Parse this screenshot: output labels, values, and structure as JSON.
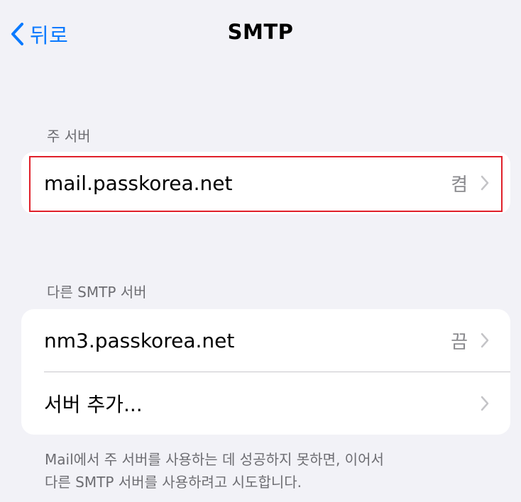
{
  "nav": {
    "back_label": "뒤로",
    "title": "SMTP"
  },
  "primary": {
    "header": "주 서버",
    "server": {
      "name": "mail.passkorea.net",
      "status": "켬"
    }
  },
  "other": {
    "header": "다른 SMTP 서버",
    "servers": [
      {
        "name": "nm3.passkorea.net",
        "status": "끔"
      }
    ],
    "add_label": "서버 추가..."
  },
  "footer": {
    "line1": "Mail에서 주 서버를 사용하는 데 성공하지 못하면, 이어서",
    "line2": "다른 SMTP 서버를 사용하려고 시도합니다."
  },
  "colors": {
    "accent": "#0a7aff",
    "background": "#f2f2f7",
    "highlight": "#e0202a"
  },
  "icons": {
    "back": "chevron-left-icon",
    "disclosure": "chevron-right-icon"
  }
}
